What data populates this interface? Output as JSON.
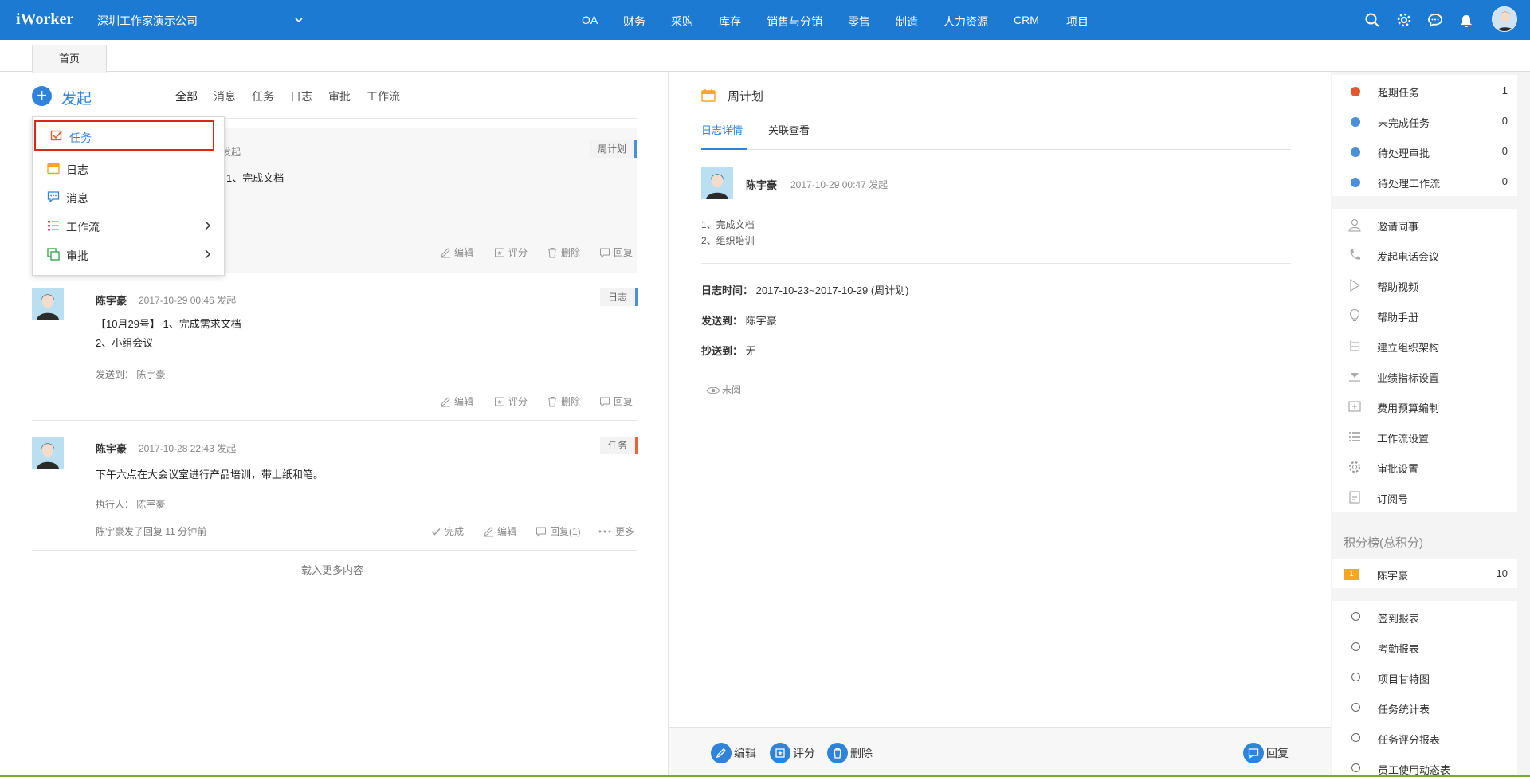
{
  "app": {
    "logo": "iWorker",
    "company": "深圳工作家演示公司"
  },
  "nav": [
    "OA",
    "财务",
    "采购",
    "库存",
    "销售与分销",
    "零售",
    "制造",
    "人力资源",
    "CRM",
    "项目"
  ],
  "tabs": {
    "home": "首页"
  },
  "feed": {
    "launch_label": "发起",
    "filters": [
      "全部",
      "消息",
      "任务",
      "日志",
      "审批",
      "工作流"
    ],
    "posts": [
      {
        "meta": "发起",
        "tag": "周计划",
        "text1": "1、完成文档",
        "actions": [
          "编辑",
          "评分",
          "删除",
          "回复"
        ]
      },
      {
        "author": "陈宇豪",
        "meta": "2017-10-29 00:46 发起",
        "tag": "日志",
        "text1": "【10月29号】 1、完成需求文档",
        "text2": "2、小组会议",
        "sent": "发送到：  陈宇豪",
        "actions": [
          "编辑",
          "评分",
          "删除",
          "回复"
        ]
      },
      {
        "author": "陈宇豪",
        "meta": "2017-10-28 22:43 发起",
        "tag": "任务",
        "text1": "下午六点在大会议室进行产品培训，带上纸和笔。",
        "executor": "执行人：  陈宇豪",
        "reply_note": "陈宇豪发了回复    11 分钟前",
        "actions": [
          "完成",
          "编辑",
          "回复(1)",
          "更多"
        ]
      }
    ],
    "load_more": "载入更多内容"
  },
  "dropdown": {
    "items": [
      {
        "label": "任务"
      },
      {
        "label": "日志"
      },
      {
        "label": "消息"
      },
      {
        "label": "工作流"
      },
      {
        "label": "审批"
      }
    ]
  },
  "detail": {
    "title": "周计划",
    "tabs": [
      "日志详情",
      "关联查看"
    ],
    "author": "陈宇豪",
    "meta": "2017-10-29 00:47   发起",
    "body1": "1、完成文档",
    "body2": "2、组织培训",
    "time_label": "日志时间：",
    "time_value": "2017-10-23~2017-10-29 (周计划)",
    "sent_label": "发送到：",
    "sent_value": "陈宇豪",
    "cc_label": "抄送到：",
    "cc_value": "无",
    "unread": "未阅",
    "footer": {
      "edit": "编辑",
      "rate": "评分",
      "delete": "删除",
      "reply": "回复"
    }
  },
  "sidebar": {
    "stats": [
      {
        "label": "超期任务",
        "count": "1",
        "color": "#e2572e"
      },
      {
        "label": "未完成任务",
        "count": "0",
        "color": "#4a90d9"
      },
      {
        "label": "待处理审批",
        "count": "0",
        "color": "#4a90d9"
      },
      {
        "label": "待处理工作流",
        "count": "0",
        "color": "#4a90d9"
      }
    ],
    "links": [
      "邀请同事",
      "发起电话会议",
      "帮助视频",
      "帮助手册",
      "建立组织架构",
      "业绩指标设置",
      "费用预算编制",
      "工作流设置",
      "审批设置",
      "订阅号"
    ],
    "rank_title": "积分榜(总积分)",
    "rank": {
      "no": "1",
      "name": "陈宇豪",
      "score": "10"
    },
    "reports": [
      "签到报表",
      "考勤报表",
      "项目甘特图",
      "任务统计表",
      "任务评分报表",
      "员工使用动态表"
    ]
  }
}
